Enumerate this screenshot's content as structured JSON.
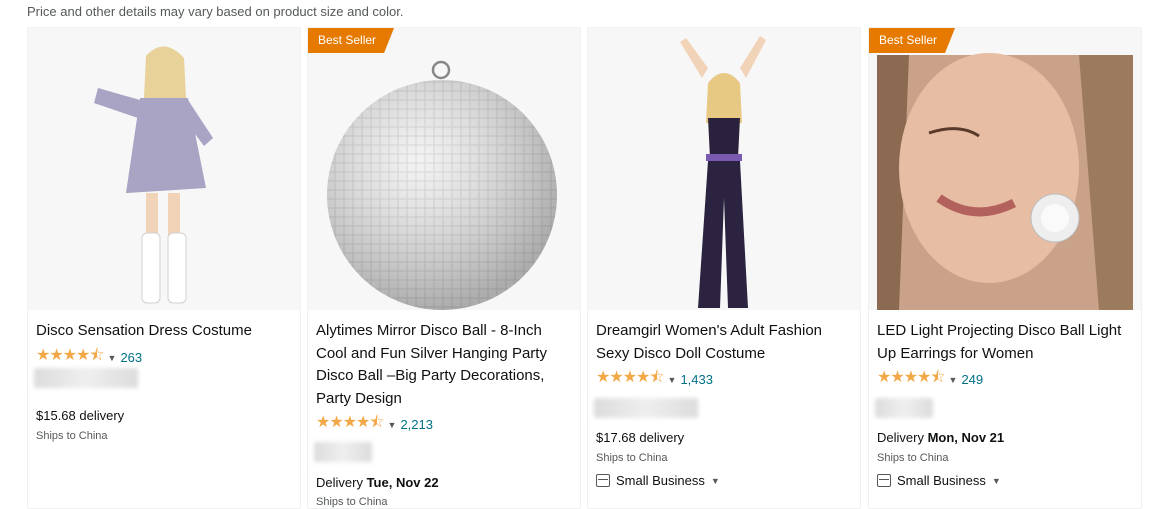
{
  "notice": "Price and other details may vary based on product size and color.",
  "products": [
    {
      "title": "Disco Sensation Dress Costume",
      "rating_count": "263",
      "delivery": "$15.68 delivery",
      "ships": "Ships to China",
      "badge": "",
      "stars": 4.5
    },
    {
      "title": "Alytimes Mirror Disco Ball - 8-Inch Cool and Fun Silver Hanging Party Disco Ball –Big Party Decorations, Party Design",
      "rating_count": "2,213",
      "delivery_prefix": "Delivery ",
      "delivery_date": "Tue, Nov 22",
      "ships": "Ships to China",
      "badge": "Best Seller",
      "stars": 4.5
    },
    {
      "title": "Dreamgirl Women's Adult Fashion Sexy Disco Doll Costume",
      "rating_count": "1,433",
      "delivery": "$17.68 delivery",
      "ships": "Ships to China",
      "small_business": "Small Business",
      "badge": "",
      "stars": 4.5
    },
    {
      "title": "LED Light Projecting Disco Ball Light Up Earrings for Women",
      "rating_count": "249",
      "delivery_prefix": "Delivery ",
      "delivery_date": "Mon, Nov 21",
      "ships": "Ships to China",
      "small_business": "Small Business",
      "badge": "Best Seller",
      "stars": 4.5
    }
  ],
  "icons": {
    "stars": "star-icon",
    "chevron": "chevron-down-icon",
    "small_business": "small-business-icon"
  },
  "colors": {
    "badge": "#e67a00",
    "stars": "#f3a847",
    "link": "#007185"
  }
}
